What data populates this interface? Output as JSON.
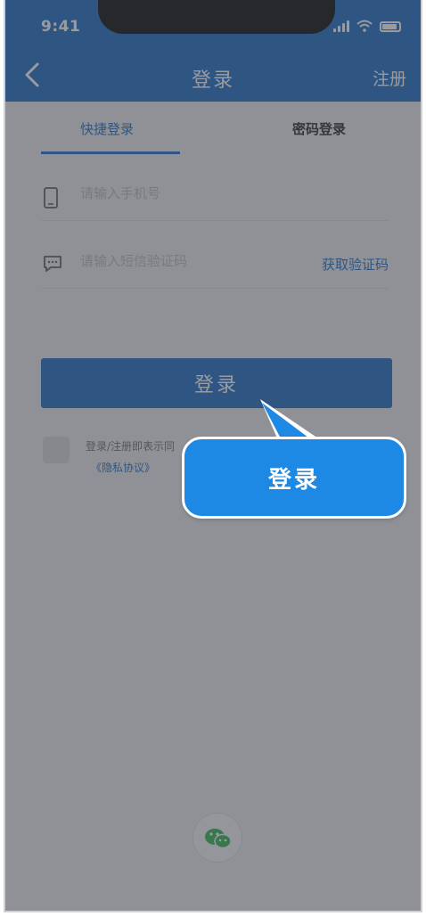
{
  "status_bar": {
    "time": "9:41"
  },
  "nav": {
    "title": "登录",
    "right_action": "注册"
  },
  "tabs": [
    {
      "label": "快捷登录",
      "active": true
    },
    {
      "label": "密码登录",
      "active": false
    }
  ],
  "form": {
    "phone_placeholder": "请输入手机号",
    "code_placeholder": "请输入短信验证码",
    "get_code_label": "获取验证码",
    "submit_label": "登录"
  },
  "agreement": {
    "text": "登录/注册即表示同",
    "privacy_link": "《隐私协议》"
  },
  "callout": {
    "label": "登录"
  },
  "colors": {
    "primary": "#1565c0",
    "callout": "#1e88e5",
    "wechat": "#2bb24c"
  },
  "icons": [
    "back-arrow-icon",
    "phone-icon",
    "sms-icon",
    "wechat-icon",
    "signal-icon",
    "wifi-icon",
    "battery-icon"
  ]
}
